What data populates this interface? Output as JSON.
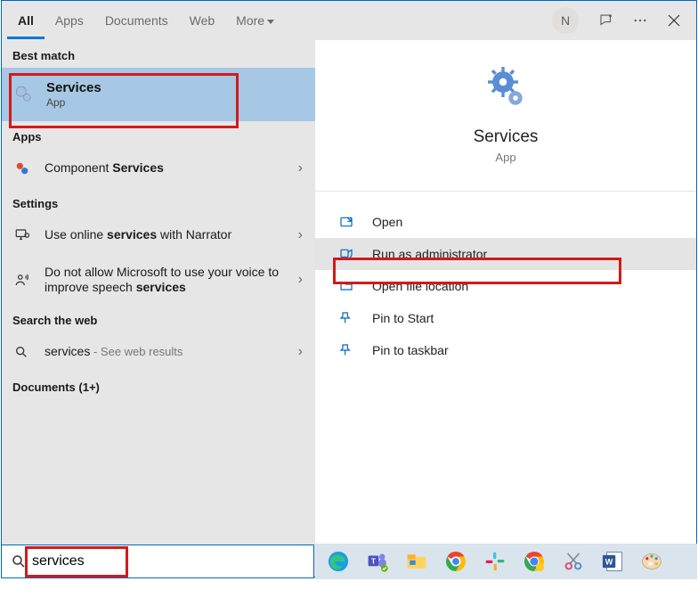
{
  "tabs": {
    "all": "All",
    "apps": "Apps",
    "documents": "Documents",
    "web": "Web",
    "more": "More"
  },
  "avatar_initial": "N",
  "sections": {
    "best": "Best match",
    "apps": "Apps",
    "settings": "Settings",
    "web": "Search the web",
    "docs": "Documents (1+)"
  },
  "best_match": {
    "title": "Services",
    "subtitle": "App"
  },
  "apps_list": {
    "component_prefix": "Component ",
    "component_bold": "Services"
  },
  "settings_list": {
    "narrator_pre": "Use online ",
    "narrator_bold": "services",
    "narrator_post": " with Narrator",
    "speech_pre": "Do not allow Microsoft to use your voice to improve speech ",
    "speech_bold": "services"
  },
  "web_list": {
    "term": "services",
    "suffix": " - See web results"
  },
  "preview": {
    "title": "Services",
    "subtitle": "App"
  },
  "actions": {
    "open": "Open",
    "admin": "Run as administrator",
    "location": "Open file location",
    "pin_start": "Pin to Start",
    "pin_taskbar": "Pin to taskbar"
  },
  "search": {
    "value": "services"
  }
}
